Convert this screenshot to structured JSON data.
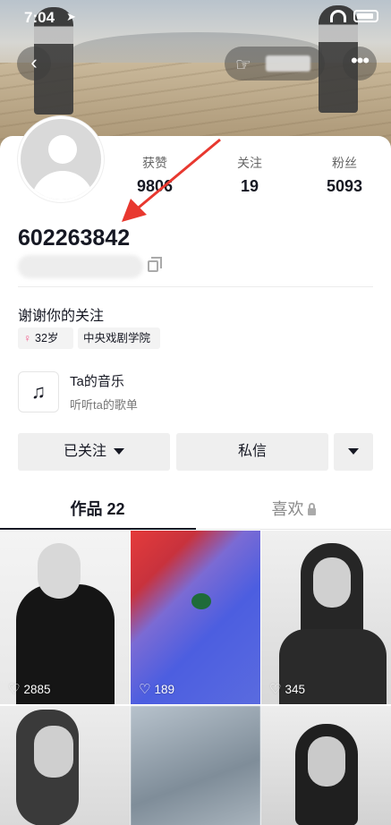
{
  "status_bar": {
    "time": "7:04"
  },
  "header": {
    "back_icon": "‹",
    "more_icon": "•••"
  },
  "profile": {
    "stats": [
      {
        "label": "获赞",
        "value": "9806"
      },
      {
        "label": "关注",
        "value": "19"
      },
      {
        "label": "粉丝",
        "value": "5093"
      }
    ],
    "user_id": "602263842",
    "bio": "谢谢你的关注",
    "tags": {
      "age": "32岁",
      "school": "中央戏剧学院"
    },
    "music": {
      "title": "Ta的音乐",
      "subtitle": "听听ta的歌单"
    }
  },
  "actions": {
    "follow_label": "已关注",
    "message_label": "私信"
  },
  "tabs": {
    "works": "作品 22",
    "likes": "喜欢"
  },
  "videos": [
    {
      "likes": "2885"
    },
    {
      "likes": "189"
    },
    {
      "likes": "345"
    }
  ],
  "colors": {
    "accent_arrow": "#e8382f",
    "gender_female": "#f25b8a"
  }
}
